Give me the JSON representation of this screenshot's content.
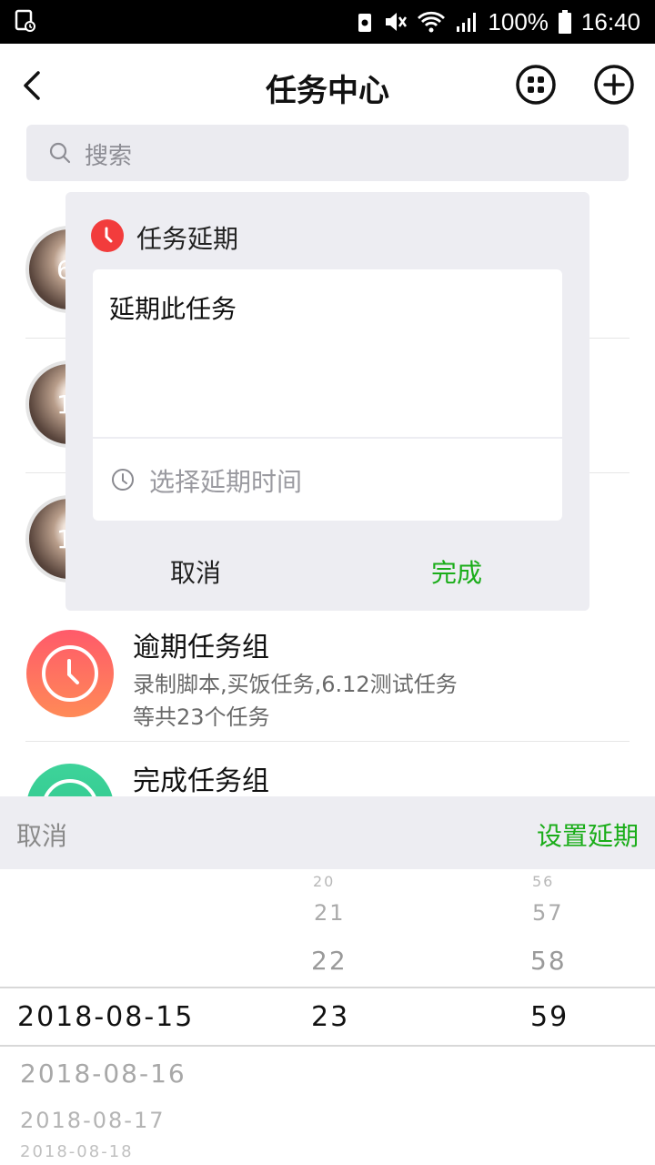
{
  "status_bar": {
    "battery": "100%",
    "time": "16:40"
  },
  "header": {
    "title": "任务中心"
  },
  "search": {
    "placeholder": "搜索"
  },
  "list": {
    "rows": [
      {
        "num": "6"
      },
      {
        "num": "1"
      },
      {
        "num": "1"
      }
    ],
    "overdue": {
      "title": "逾期任务组",
      "line1": "录制脚本,买饭任务,6.12测试任务",
      "line2": "等共23个任务"
    },
    "done": {
      "title": "完成任务组"
    }
  },
  "dialog": {
    "title": "任务延期",
    "content": "延期此任务",
    "time_placeholder": "选择延期时间",
    "cancel": "取消",
    "confirm": "完成"
  },
  "picker": {
    "cancel": "取消",
    "confirm": "设置延期",
    "dates": [
      "2018-08-15",
      "2018-08-16",
      "2018-08-17",
      "2018-08-18"
    ],
    "hours": [
      "20",
      "21",
      "22",
      "23"
    ],
    "minutes": [
      "56",
      "57",
      "58",
      "59"
    ]
  },
  "colors": {
    "accent": "#1aad19",
    "overdue": "#ff5a6a",
    "done": "#2cc58a",
    "danger": "#f23c3c"
  }
}
